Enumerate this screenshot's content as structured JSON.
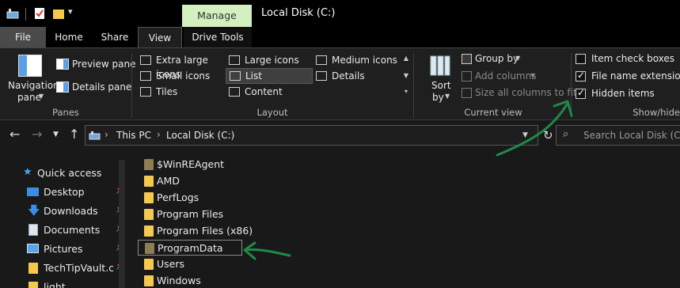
{
  "titlebar": {
    "title": "Local Disk (C:)",
    "context_tab": "Manage",
    "qat_dropdown": "▾"
  },
  "tabs": [
    "File",
    "Home",
    "Share",
    "View",
    "Drive Tools"
  ],
  "ribbon": {
    "panes": {
      "navigation_pane": "Navigation pane",
      "navigation_pane_line1": "Navigation",
      "navigation_pane_line2": "pane",
      "preview_pane": "Preview pane",
      "details_pane": "Details pane",
      "label": "Panes"
    },
    "layout": {
      "items": [
        "Extra large icons",
        "Large icons",
        "Medium icons",
        "Small icons",
        "List",
        "Details",
        "Tiles",
        "Content"
      ],
      "selected": "List",
      "label": "Layout"
    },
    "current_view": {
      "sort_by_line1": "Sort",
      "sort_by_line2": "by",
      "group_by": "Group by",
      "add_columns": "Add columns",
      "size_all_columns": "Size all columns to fit",
      "label": "Current view"
    },
    "show_hide": {
      "item_check_boxes": "Item check boxes",
      "item_check_boxes_checked": false,
      "file_name_extensions": "File name extensions",
      "file_name_extensions_checked": true,
      "hidden_items": "Hidden items",
      "hidden_items_checked": true,
      "label": "Show/hide"
    }
  },
  "address": {
    "crumbs": [
      "This PC",
      "Local Disk (C:)"
    ],
    "separator": "›",
    "search_placeholder": "Search Local Disk (C:)"
  },
  "nav": {
    "quick_access": "Quick access",
    "items": [
      {
        "label": "Desktop",
        "pinned": true
      },
      {
        "label": "Downloads",
        "pinned": true
      },
      {
        "label": "Documents",
        "pinned": true
      },
      {
        "label": "Pictures",
        "pinned": true
      },
      {
        "label": "TechTipVault.cor",
        "pinned": true
      },
      {
        "label": "light",
        "pinned": false
      }
    ]
  },
  "files": {
    "items": [
      {
        "name": "$WinREAgent",
        "hidden": true
      },
      {
        "name": "AMD",
        "hidden": false
      },
      {
        "name": "PerfLogs",
        "hidden": false
      },
      {
        "name": "Program Files",
        "hidden": false
      },
      {
        "name": "Program Files (x86)",
        "hidden": false
      },
      {
        "name": "ProgramData",
        "hidden": true
      },
      {
        "name": "Users",
        "hidden": false
      },
      {
        "name": "Windows",
        "hidden": false
      }
    ],
    "selected": "ProgramData"
  },
  "colors": {
    "manage_tab": "#d4f0c0",
    "annotation": "#1e8a4a",
    "folder": "#f5c94d",
    "hidden_folder": "#8e7d52"
  }
}
